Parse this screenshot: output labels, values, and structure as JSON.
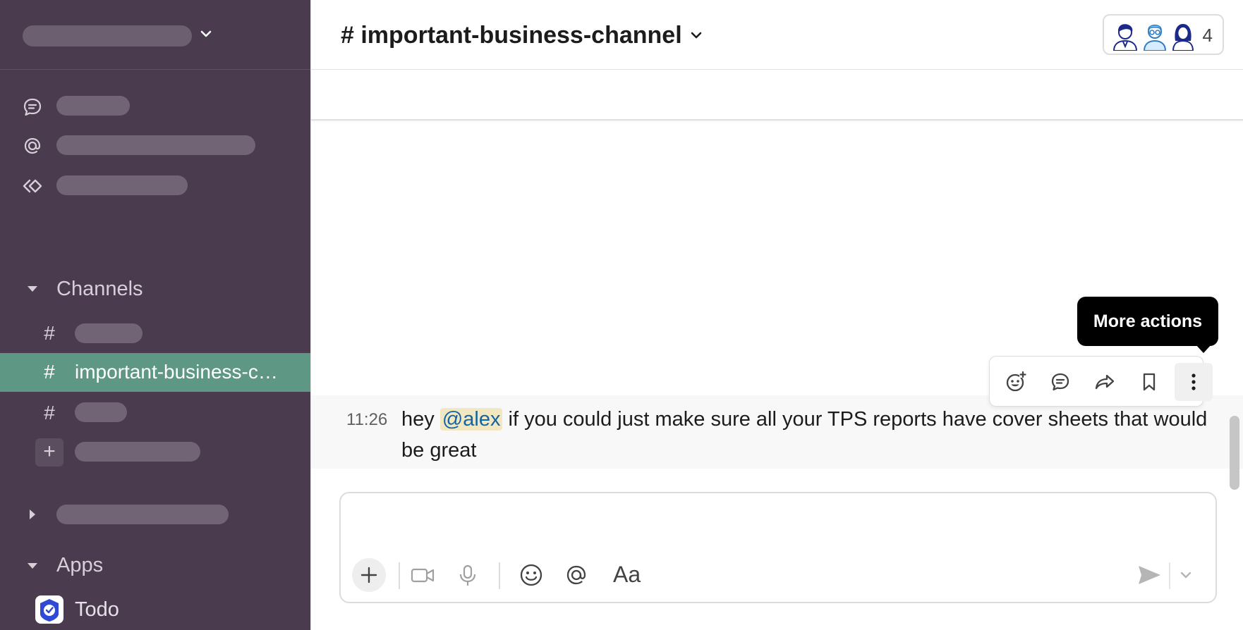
{
  "channel": {
    "title": "# important-business-channel",
    "member_count": "4"
  },
  "sidebar": {
    "channels_label": "Channels",
    "active_channel": "important-business-c…",
    "apps_label": "Apps",
    "apps": [
      {
        "label": "Todo",
        "icon": "todo-app-icon"
      }
    ]
  },
  "message": {
    "time": "11:26",
    "text_before": "hey ",
    "mention": "@alex",
    "text_after": " if you could just make sure all your TPS reports have cover sheets that would be great"
  },
  "tooltip": {
    "label": "More actions"
  },
  "composer": {
    "placeholder": "",
    "format_label": "Aa"
  },
  "colors": {
    "sidebar_bg": "#4a3c4e",
    "active_channel_bg": "#5e9783",
    "mention_bg": "#f2e7c3",
    "mention_fg": "#1264a3"
  }
}
